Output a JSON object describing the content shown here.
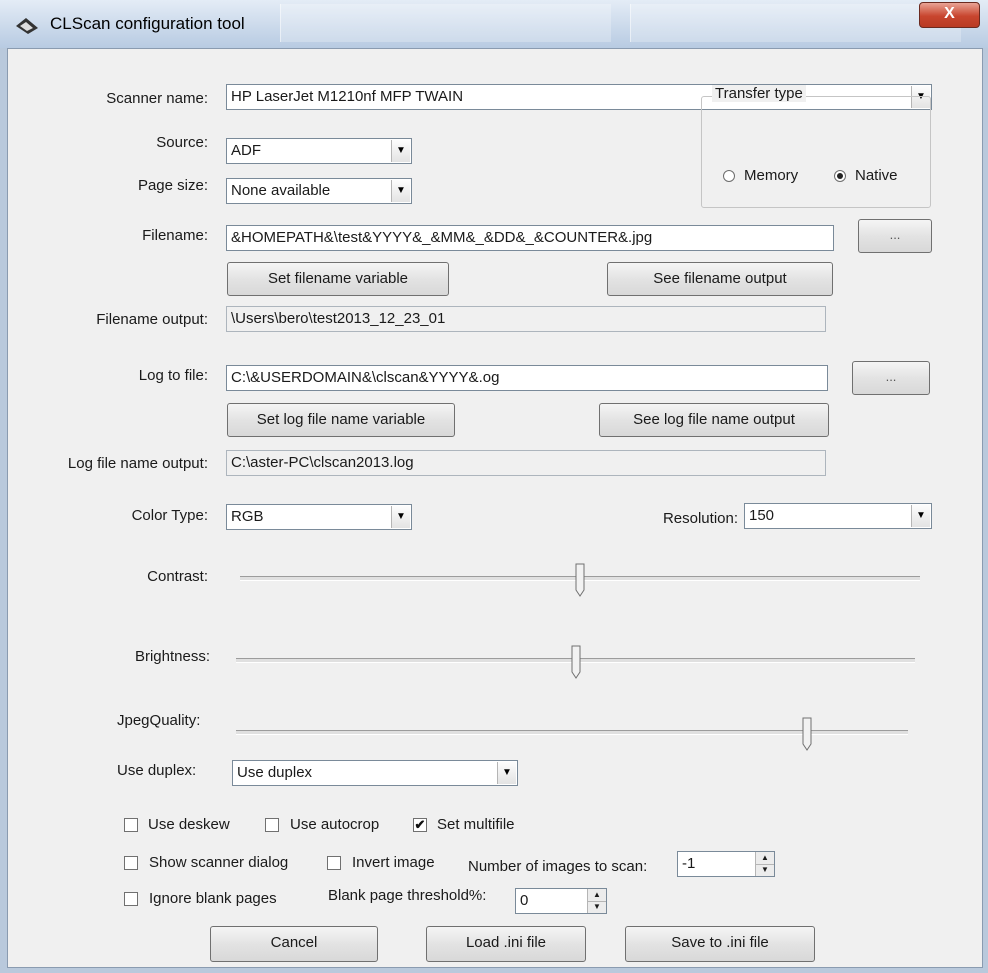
{
  "window": {
    "title": "CLScan configuration tool",
    "close_label": "X"
  },
  "scanner": {
    "label": "Scanner name:",
    "value": "HP LaserJet M1210nf MFP TWAIN"
  },
  "source": {
    "label": "Source:",
    "value": "ADF"
  },
  "page_size": {
    "label": "Page size:",
    "value": "None available"
  },
  "transfer": {
    "title": "Transfer type",
    "memory_label": "Memory",
    "native_label": "Native",
    "selected": "Native"
  },
  "filename": {
    "label": "Filename:",
    "value": "&HOMEPATH&\\test&YYYY&_&MM&_&DD&_&COUNTER&.jpg",
    "browse_label": "...",
    "set_variable_label": "Set filename variable",
    "see_output_label": "See filename output",
    "output_label": "Filename output:",
    "output_value": "\\Users\\bero\\test2013_12_23_01"
  },
  "log": {
    "label": "Log to file:",
    "value": "C:\\&USERDOMAIN&\\clscan&YYYY&.og",
    "browse_label": "...",
    "set_variable_label": "Set log file name variable",
    "see_output_label": "See log file name output",
    "output_label": "Log file name output:",
    "output_value": "C:\\aster-PC\\clscan2013.log"
  },
  "color_type": {
    "label": "Color Type:",
    "value": "RGB"
  },
  "resolution": {
    "label": "Resolution:",
    "value": "150"
  },
  "sliders": {
    "contrast": {
      "label": "Contrast:",
      "level": 0.5
    },
    "brightness": {
      "label": "Brightness:",
      "level": 0.5
    },
    "jpeg_quality": {
      "label": "JpegQuality:",
      "level": 0.85
    }
  },
  "duplex": {
    "label": "Use duplex:",
    "value": "Use duplex"
  },
  "options": {
    "deskew": {
      "label": "Use deskew",
      "checked": false
    },
    "autocrop": {
      "label": "Use autocrop",
      "checked": false
    },
    "multifile": {
      "label": "Set multifile",
      "checked": true
    },
    "scanner_dialog": {
      "label": "Show scanner dialog",
      "checked": false
    },
    "invert_image": {
      "label": "Invert image",
      "checked": false
    },
    "ignore_blank": {
      "label": "Ignore blank pages",
      "checked": false
    }
  },
  "num_images": {
    "label": "Number of images to scan:",
    "value": "-1"
  },
  "blank_threshold": {
    "label": "Blank page threshold%:",
    "value": "0"
  },
  "footer": {
    "cancel_label": "Cancel",
    "load_label": "Load .ini file",
    "save_label": "Save to .ini file"
  }
}
